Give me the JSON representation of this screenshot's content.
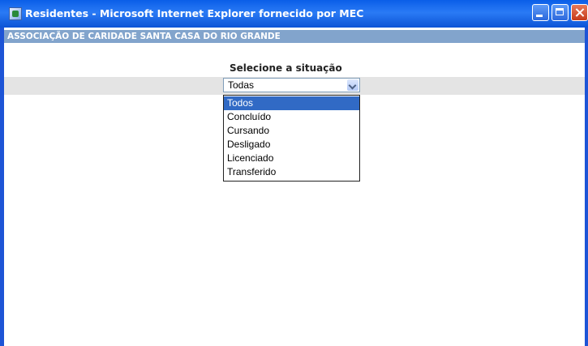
{
  "window": {
    "title": "Residentes - Microsoft Internet Explorer fornecido por MEC",
    "controls": [
      "minimize-icon",
      "maximize-icon",
      "close-icon"
    ]
  },
  "page": {
    "organization": "ASSOCIAÇÃO DE CARIDADE SANTA CASA DO RIO GRANDE",
    "select_label": "Selecione a situação",
    "select": {
      "value": "Todas",
      "options": [
        "Todos",
        "Concluído",
        "Cursando",
        "Desligado",
        "Licenciado",
        "Transferido"
      ],
      "highlighted": "Todos"
    }
  },
  "colors": {
    "titlebar": "#0a5ee8",
    "header_band": "#82a4cc",
    "highlight": "#316ac5"
  }
}
